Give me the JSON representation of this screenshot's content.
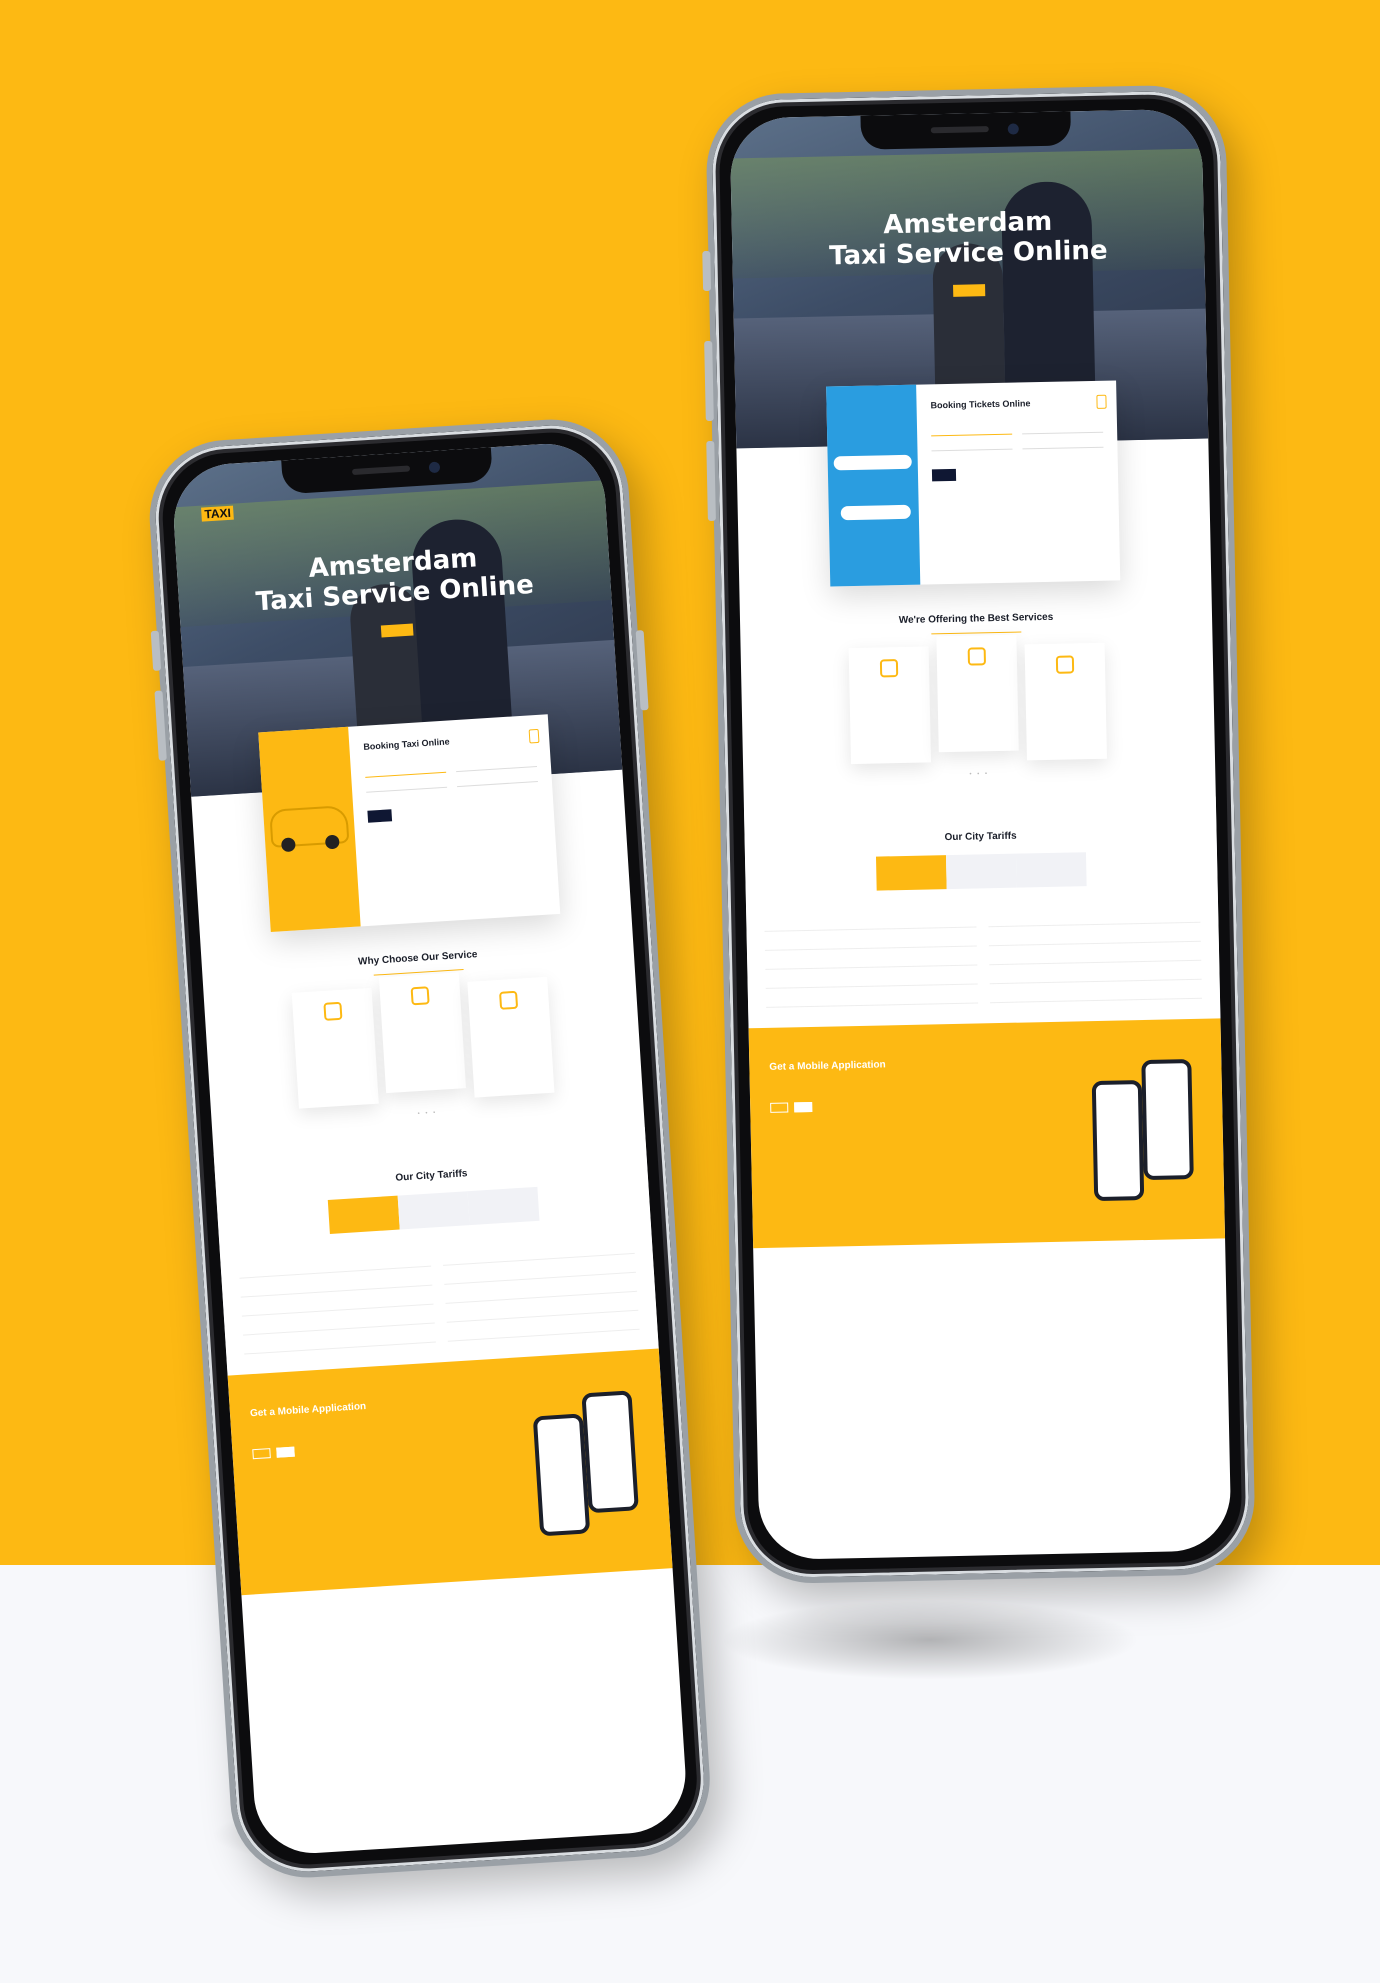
{
  "colors": {
    "brand": "#fdb913",
    "dark": "#0f1733",
    "backdrop": "#f7f8fb"
  },
  "left_phone": {
    "logo": {
      "text": "TAXI",
      "accent": ""
    },
    "hero": {
      "title_line1": "Amsterdam",
      "title_line2": "Taxi Service Online",
      "cta": ""
    },
    "booking": {
      "title": "Booking Taxi Online",
      "tabs": [
        "",
        "",
        ""
      ],
      "fields": [
        "",
        "",
        "",
        ""
      ],
      "button": ""
    },
    "advantages": {
      "eyebrow": "",
      "title": "Why Choose Our Service",
      "cards": [
        {
          "title": "",
          "desc": "",
          "more": ""
        },
        {
          "title": "",
          "desc": "",
          "more": ""
        },
        {
          "title": "",
          "desc": "",
          "more": ""
        }
      ]
    },
    "tariffs": {
      "eyebrow": "",
      "title": "Our City Tariffs",
      "tabs": [
        "",
        "",
        ""
      ],
      "subtabs": [
        "",
        "",
        "",
        "",
        ""
      ],
      "items": [
        {
          "name": "",
          "sub": "",
          "price": ""
        },
        {
          "name": "",
          "sub": "",
          "price": ""
        },
        {
          "name": "",
          "sub": "",
          "price": ""
        },
        {
          "name": "",
          "sub": "",
          "price": ""
        },
        {
          "name": "",
          "sub": "",
          "price": ""
        },
        {
          "name": "",
          "sub": "",
          "price": ""
        },
        {
          "name": "",
          "sub": "",
          "price": ""
        },
        {
          "name": "",
          "sub": "",
          "price": ""
        },
        {
          "name": "",
          "sub": "",
          "price": ""
        },
        {
          "name": "",
          "sub": "",
          "price": ""
        }
      ]
    },
    "app": {
      "eyebrow": "",
      "title": "Get a Mobile Application",
      "desc": "",
      "features": [
        "",
        "",
        "",
        ""
      ],
      "stores": [
        "",
        ""
      ]
    }
  },
  "right_phone": {
    "hero": {
      "title_line1": "Amsterdam",
      "title_line2": "Taxi Service Online",
      "cta": ""
    },
    "booking": {
      "title": "Booking Tickets Online",
      "tabs": [
        "",
        "",
        ""
      ],
      "fields": [
        "",
        "",
        "",
        ""
      ],
      "button": ""
    },
    "advantages": {
      "eyebrow": "",
      "title": "We're Offering the Best Services",
      "cards": [
        {
          "title": "",
          "desc": "",
          "more": ""
        },
        {
          "title": "",
          "desc": "",
          "more": ""
        },
        {
          "title": "",
          "desc": "",
          "more": ""
        }
      ]
    },
    "tariffs": {
      "eyebrow": "",
      "title": "Our City Tariffs",
      "tabs": [
        "",
        "",
        ""
      ],
      "subtabs": [
        "",
        "",
        "",
        "",
        ""
      ],
      "items": [
        {
          "name": "",
          "sub": "",
          "price": ""
        },
        {
          "name": "",
          "sub": "",
          "price": ""
        },
        {
          "name": "",
          "sub": "",
          "price": ""
        },
        {
          "name": "",
          "sub": "",
          "price": ""
        },
        {
          "name": "",
          "sub": "",
          "price": ""
        },
        {
          "name": "",
          "sub": "",
          "price": ""
        },
        {
          "name": "",
          "sub": "",
          "price": ""
        },
        {
          "name": "",
          "sub": "",
          "price": ""
        },
        {
          "name": "",
          "sub": "",
          "price": ""
        },
        {
          "name": "",
          "sub": "",
          "price": ""
        }
      ]
    },
    "app": {
      "eyebrow": "",
      "title": "Get a Mobile Application",
      "desc": "",
      "features": [
        "",
        "",
        "",
        ""
      ],
      "stores": [
        "",
        ""
      ]
    }
  }
}
